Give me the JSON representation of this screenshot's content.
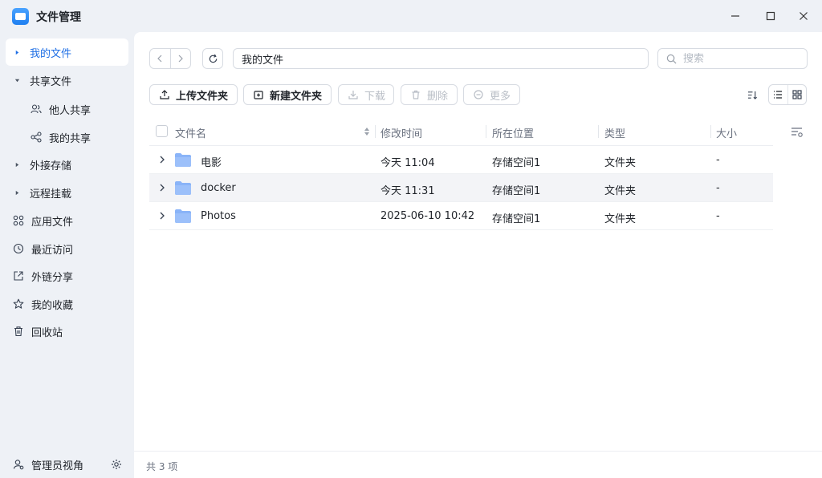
{
  "window": {
    "title": "文件管理"
  },
  "sidebar": {
    "items": [
      {
        "label": "我的文件"
      },
      {
        "label": "共享文件"
      },
      {
        "label": "他人共享"
      },
      {
        "label": "我的共享"
      },
      {
        "label": "外接存储"
      },
      {
        "label": "远程挂载"
      },
      {
        "label": "应用文件"
      },
      {
        "label": "最近访问"
      },
      {
        "label": "外链分享"
      },
      {
        "label": "我的收藏"
      },
      {
        "label": "回收站"
      }
    ],
    "footer": {
      "label": "管理员视角"
    }
  },
  "pathbar": {
    "path": "我的文件"
  },
  "search": {
    "placeholder": "搜索"
  },
  "toolbar": {
    "upload": "上传文件夹",
    "new_folder": "新建文件夹",
    "download": "下载",
    "delete": "删除",
    "more": "更多"
  },
  "table": {
    "columns": [
      "文件名",
      "修改时间",
      "所在位置",
      "类型",
      "大小"
    ],
    "rows": [
      {
        "name": "电影",
        "modified": "今天 11:04",
        "location": "存储空间1",
        "type": "文件夹",
        "size": "-"
      },
      {
        "name": "docker",
        "modified": "今天 11:31",
        "location": "存储空间1",
        "type": "文件夹",
        "size": "-"
      },
      {
        "name": "Photos",
        "modified": "2025-06-10 10:42",
        "location": "存储空间1",
        "type": "文件夹",
        "size": "-"
      }
    ]
  },
  "status": {
    "count": "共 3 项"
  },
  "colors": {
    "accent": "#1f6fe5",
    "folder": "#8ab4f8",
    "sidebar_bg": "#eef1f6"
  }
}
